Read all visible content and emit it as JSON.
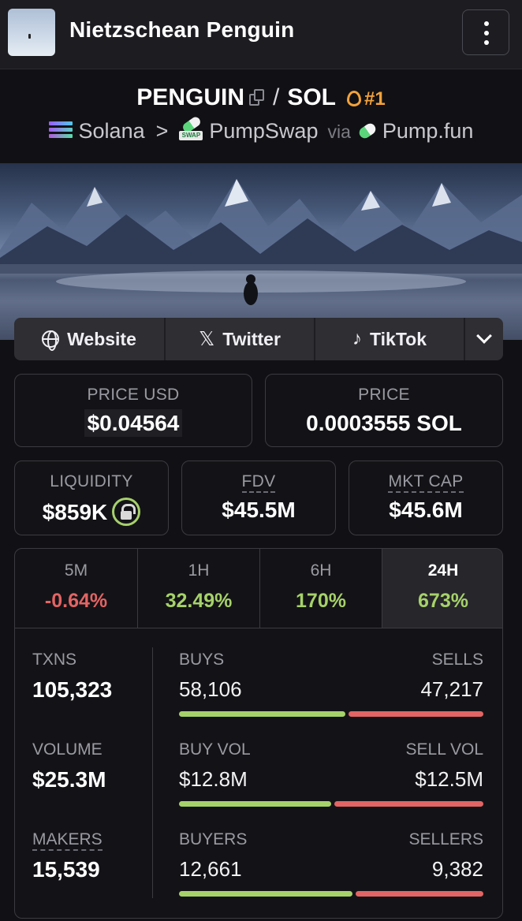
{
  "header": {
    "token_name": "Nietzschean Penguin",
    "menu_icon": "more-vertical-icon"
  },
  "pair": {
    "base": "PENGUIN",
    "separator": "/",
    "quote": "SOL",
    "rank": "#1",
    "chain": "Solana",
    "dex": "PumpSwap",
    "dex_badge": "SWAP",
    "via": "via",
    "launchpad": "Pump.fun"
  },
  "links": {
    "website": "Website",
    "twitter": "Twitter",
    "tiktok": "TikTok"
  },
  "stats": {
    "price_usd_label": "PRICE USD",
    "price_usd": "$0.04564",
    "price_label": "PRICE",
    "price_native": "0.0003555 SOL",
    "liquidity_label": "LIQUIDITY",
    "liquidity": "$859K",
    "fdv_label": "FDV",
    "fdv": "$45.5M",
    "mktcap_label": "MKT CAP",
    "mktcap": "$45.6M"
  },
  "timeframes": [
    {
      "label": "5M",
      "change": "-0.64%",
      "direction": "down"
    },
    {
      "label": "1H",
      "change": "32.49%",
      "direction": "up"
    },
    {
      "label": "6H",
      "change": "170%",
      "direction": "up"
    },
    {
      "label": "24H",
      "change": "673%",
      "direction": "up",
      "selected": true
    }
  ],
  "activity": {
    "txns_label": "TXNS",
    "txns": "105,323",
    "volume_label": "VOLUME",
    "volume": "$25.3M",
    "makers_label": "MAKERS",
    "makers": "15,539",
    "buys_label": "BUYS",
    "buys": "58,106",
    "sells_label": "SELLS",
    "sells": "47,217",
    "buy_vol_label": "BUY VOL",
    "buy_vol": "$12.8M",
    "sell_vol_label": "SELL VOL",
    "sell_vol": "$12.5M",
    "buyers_label": "BUYERS",
    "buyers": "12,661",
    "sellers_label": "SELLERS",
    "sellers": "9,382",
    "buys_share": 0.552,
    "buy_vol_share": 0.506,
    "buyers_share": 0.574
  },
  "colors": {
    "positive": "#a6d26a",
    "negative": "#e36464",
    "rank": "#f2a23b",
    "background": "#111115"
  }
}
